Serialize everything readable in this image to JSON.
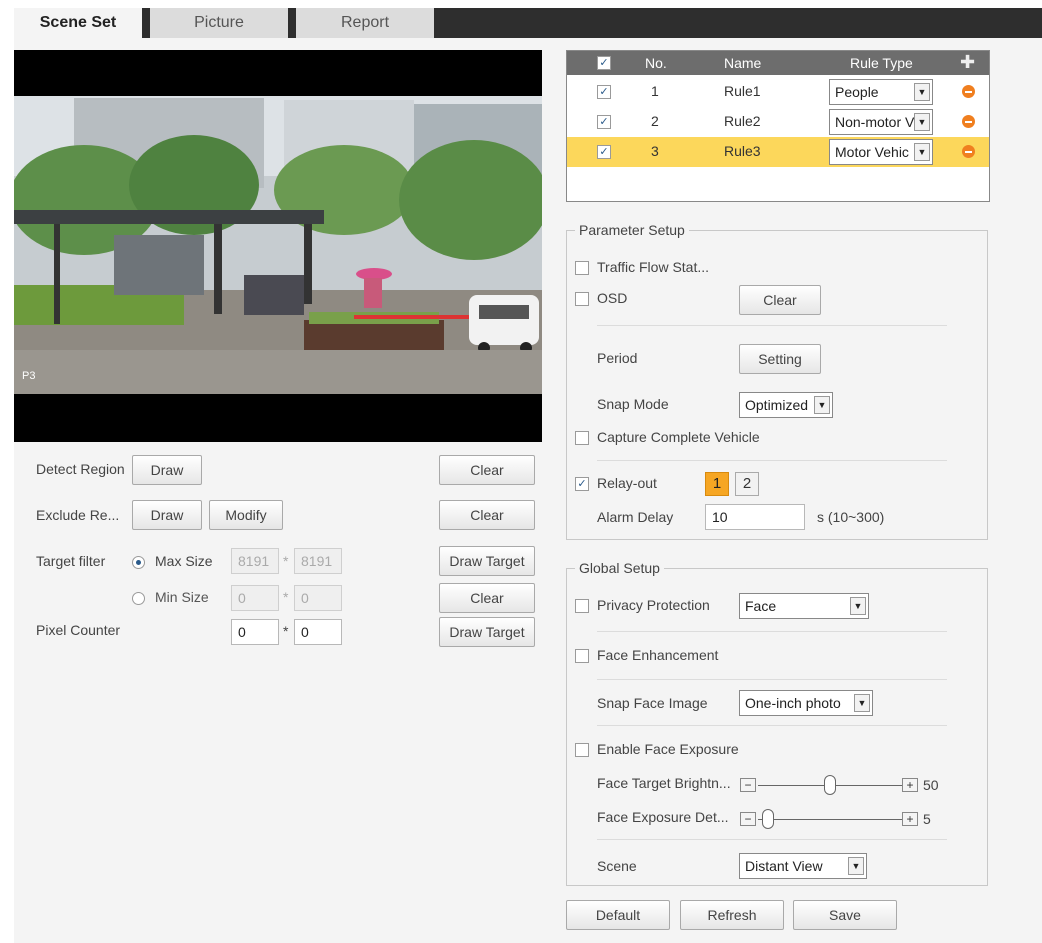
{
  "tabs": [
    {
      "label": "Scene Set"
    },
    {
      "label": "Picture"
    },
    {
      "label": "Report"
    }
  ],
  "video": {
    "watermark": "P3"
  },
  "left": {
    "detect_region_label": "Detect Region",
    "draw_label": "Draw",
    "clear_label": "Clear",
    "exclude_region_label": "Exclude Re...",
    "modify_label": "Modify",
    "target_filter_label": "Target filter",
    "max_size_label": "Max Size",
    "max_w": "8191",
    "max_h": "8191",
    "min_size_label": "Min Size",
    "min_w": "0",
    "min_h": "0",
    "draw_target_label": "Draw Target",
    "pixel_counter_label": "Pixel Counter",
    "pix_w": "0",
    "pix_h": "0",
    "times": "*"
  },
  "rule_table": {
    "headers": {
      "no": "No.",
      "name": "Name",
      "rule_type": "Rule Type"
    },
    "rows": [
      {
        "no": "1",
        "name": "Rule1",
        "type": "People"
      },
      {
        "no": "2",
        "name": "Rule2",
        "type": "Non-motor V"
      },
      {
        "no": "3",
        "name": "Rule3",
        "type": "Motor Vehic"
      }
    ]
  },
  "param": {
    "title": "Parameter Setup",
    "traffic_flow": "Traffic Flow Stat...",
    "osd": "OSD",
    "clear": "Clear",
    "period": "Period",
    "setting": "Setting",
    "snap_mode": "Snap Mode",
    "snap_mode_value": "Optimized",
    "capture_complete": "Capture Complete Vehicle",
    "relay_out": "Relay-out",
    "relay_1": "1",
    "relay_2": "2",
    "alarm_delay": "Alarm Delay",
    "alarm_delay_value": "10",
    "alarm_delay_unit": "s (10~300)"
  },
  "global": {
    "title": "Global Setup",
    "privacy": "Privacy Protection",
    "privacy_value": "Face",
    "face_enhancement": "Face Enhancement",
    "snap_face_image": "Snap Face Image",
    "snap_face_value": "One-inch photo",
    "enable_face_exposure": "Enable Face Exposure",
    "face_target_brightness": "Face Target Brightn...",
    "face_target_brightness_value": "50",
    "face_exposure_detect": "Face Exposure Det...",
    "face_exposure_detect_value": "5",
    "scene": "Scene",
    "scene_value": "Distant View"
  },
  "footer": {
    "default": "Default",
    "refresh": "Refresh",
    "save": "Save"
  },
  "colors": {
    "tab_bar": "#2e2e2e",
    "selected_row": "#fcd75b",
    "relay_active": "#f6a623",
    "remove_icon": "#f07f1f"
  }
}
